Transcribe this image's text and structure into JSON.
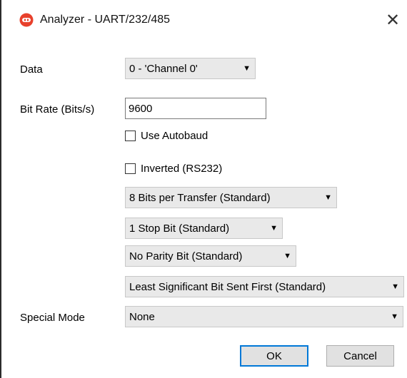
{
  "window": {
    "title": "Analyzer - UART/232/485",
    "close_glyph": "✕",
    "app_icon": "logic-analyzer-icon",
    "accent": "#e8412c"
  },
  "form": {
    "data_label": "Data",
    "data_value": "0 - 'Channel 0'",
    "bitrate_label": "Bit Rate (Bits/s)",
    "bitrate_value": "9600",
    "autobaud_label": "Use Autobaud",
    "autobaud_checked": false,
    "inverted_label": "Inverted (RS232)",
    "inverted_checked": false,
    "bits_per_transfer": "8 Bits per Transfer (Standard)",
    "stop_bits": "1 Stop Bit (Standard)",
    "parity": "No Parity Bit (Standard)",
    "bit_order": "Least Significant Bit Sent First (Standard)",
    "special_mode_label": "Special Mode",
    "special_mode_value": "None"
  },
  "buttons": {
    "ok": "OK",
    "cancel": "Cancel"
  },
  "arrow_glyph": "▼"
}
